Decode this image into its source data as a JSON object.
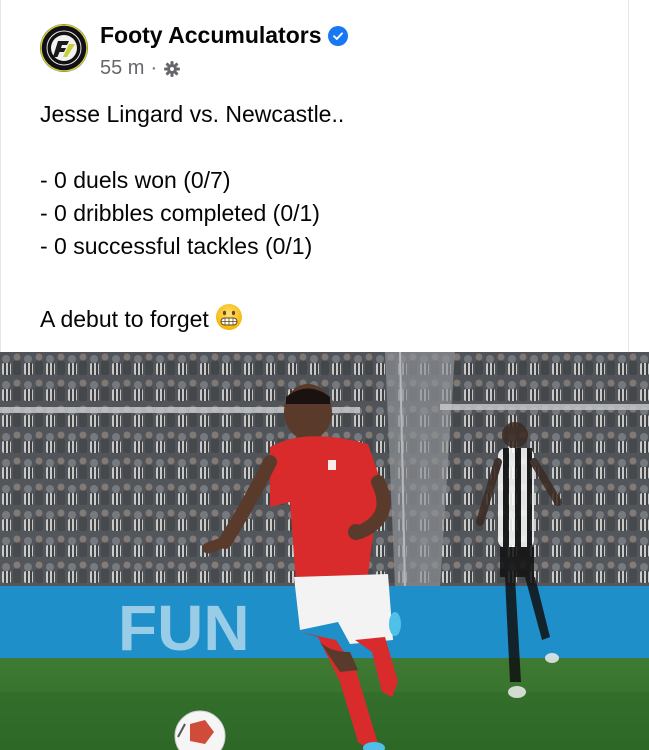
{
  "post": {
    "author": "Footy Accumulators",
    "timestamp": "55 m",
    "separator": "·",
    "audience_icon": "gear-icon",
    "verified_icon": "verified-badge-icon",
    "lines": {
      "intro": "Jesse Lingard vs. Newcastle..",
      "stat1": "- 0 duels won (0/7)",
      "stat2": "- 0 dribbles completed (0/1)",
      "stat3": "- 0 successful tackles (0/1)",
      "outro": "A debut to forget"
    },
    "emoji": "grimacing-face-icon",
    "photo": {
      "ad_board_text": "FUN",
      "colors": {
        "pitch": "#3f7a34",
        "ad_board": "#1e8fc8",
        "home_kit": "#d92b2b"
      }
    }
  }
}
